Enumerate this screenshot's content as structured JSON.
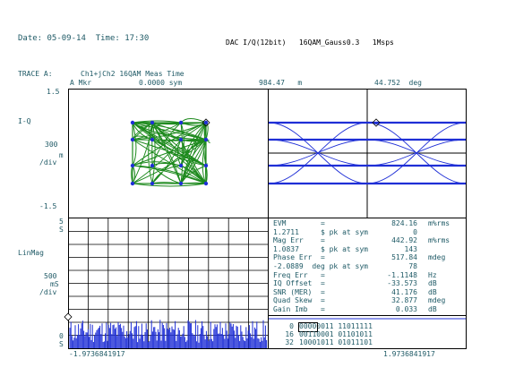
{
  "header": {
    "date_time": "Date: 05-09-14  Time: 17:30",
    "instrument_title": "DAC I/Q(12bit)   16QAM_Gauss0.3   1Msps"
  },
  "trace": {
    "label": "TRACE A:",
    "description": "Ch1+jCh2 16QAM Meas Time",
    "marker_label": "A Mkr",
    "marker_value": "0.0000 sym",
    "marker_level": "984.47   m",
    "marker_phase": "44.752  deg"
  },
  "iq_plot": {
    "top_value": "1.5",
    "axis_label": "I-Q",
    "scale_value": "300",
    "scale_unit_div": "/div",
    "scale_unit_m": "m",
    "bottom_value": "-1.5",
    "constellation_color": "#1e8a1e",
    "symbol_color": "#1f2fd6"
  },
  "eye_diagram": {
    "trace_color": "#1f2fd6"
  },
  "spectrum_plot": {
    "top_value": "5",
    "top_unit": "S",
    "axis_label": "LinMag",
    "scale_value": "500",
    "scale_unit": "mS",
    "scale_div": "/div",
    "bottom_value": "0",
    "bottom_unit": "S",
    "x_start": "-1.9736841917",
    "x_end": "1.9736841917",
    "trace_color": "#1f2fd6"
  },
  "error_summary": {
    "rows": [
      {
        "label": "EVM        =",
        "value": "824.16",
        "unit": "m%rms"
      },
      {
        "label": "1.2711     $ pk at sym",
        "value": "0",
        "unit": ""
      },
      {
        "label": "Mag Err    =",
        "value": "442.92",
        "unit": "m%rms"
      },
      {
        "label": "1.0837     $ pk at sym",
        "value": "143",
        "unit": ""
      },
      {
        "label": "Phase Err  =",
        "value": "517.84",
        "unit": "mdeg"
      },
      {
        "label": "-2.0889  deg pk at sym",
        "value": "78",
        "unit": ""
      },
      {
        "label": "Freq Err   =",
        "value": "-1.1148",
        "unit": "Hz"
      },
      {
        "label": "IQ Offset  =",
        "value": "-33.573",
        "unit": "dB"
      },
      {
        "label": "SNR (MER)  =",
        "value": "41.176",
        "unit": "dB"
      },
      {
        "label": "Quad Skew  =",
        "value": "32.877",
        "unit": "mdeg"
      },
      {
        "label": "Gain Imb   =",
        "value": "0.033",
        "unit": "dB"
      }
    ]
  },
  "symbol_table": {
    "rows": [
      {
        "index": "0",
        "bits": "00000011 11011111",
        "highlight": "0000"
      },
      {
        "index": "16",
        "bits": "00110001 01101011",
        "highlight": ""
      },
      {
        "index": "32",
        "bits": "10001011 01011101",
        "highlight": ""
      }
    ]
  }
}
